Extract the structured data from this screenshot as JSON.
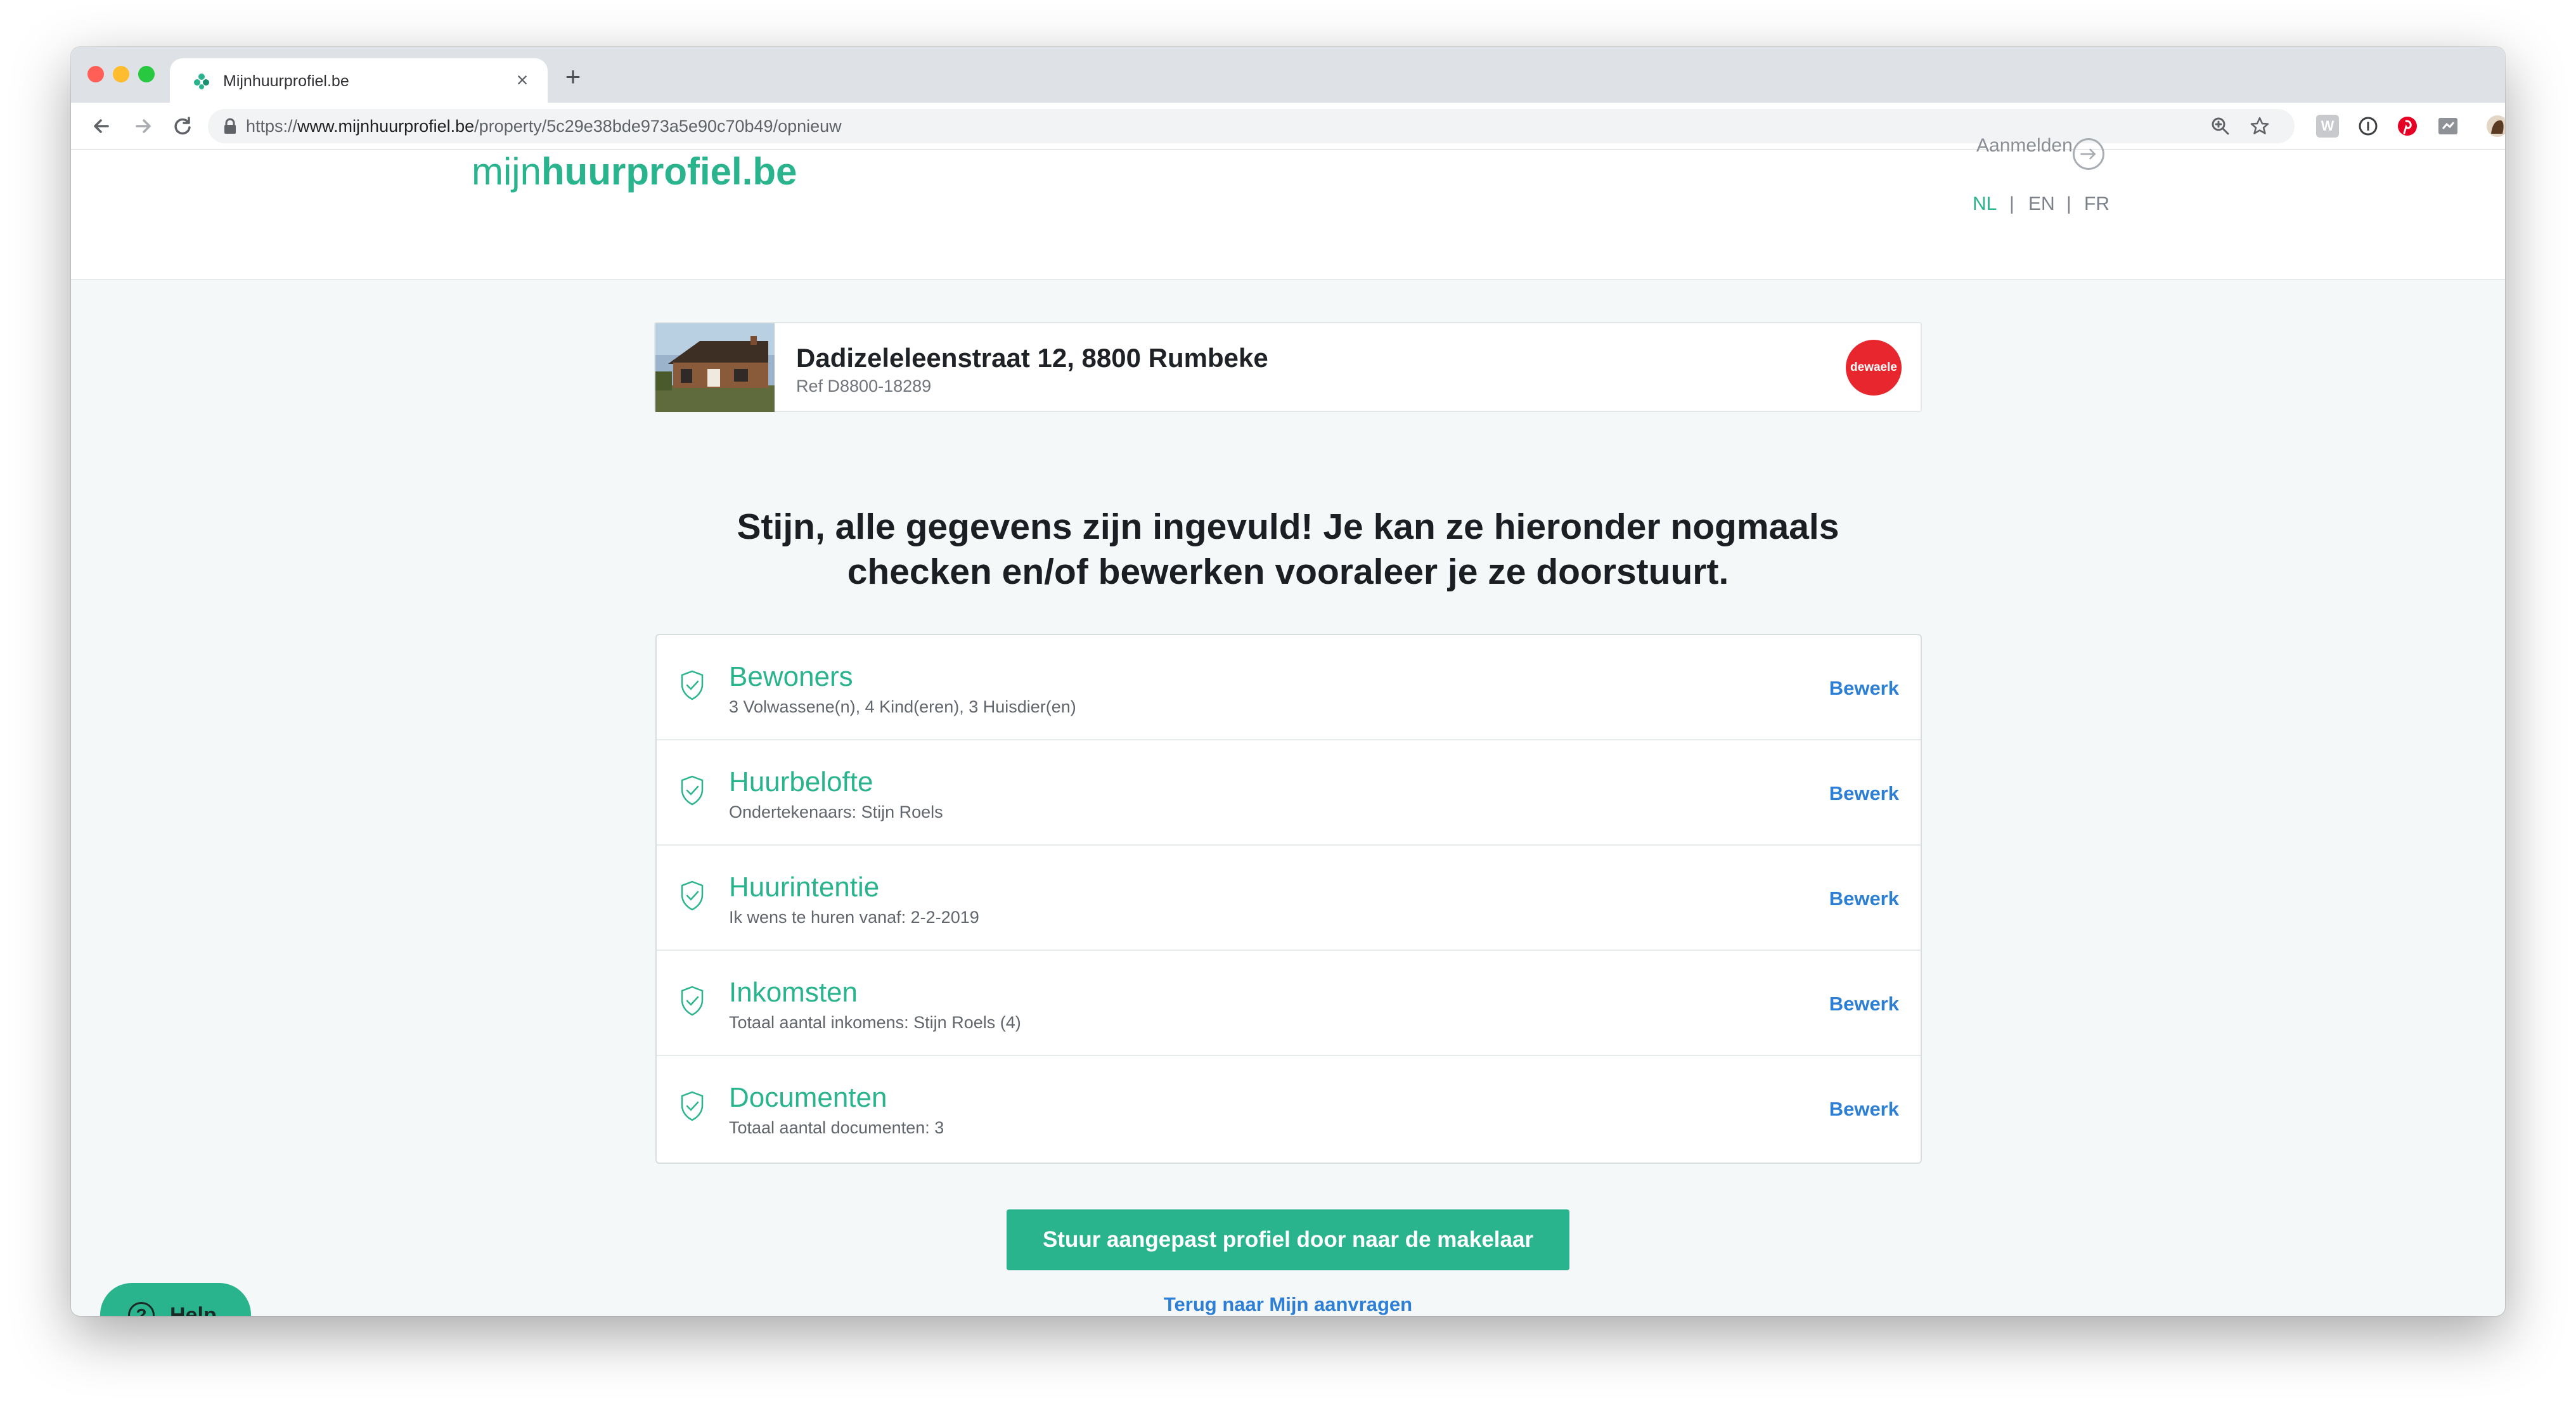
{
  "browser": {
    "tab_title": "Mijnhuurprofiel.be",
    "tab_close": "×",
    "new_tab": "+",
    "url_prefix": "https://",
    "url_host": "www.mijnhuurprofiel.be",
    "url_path": "/property/5c29e38bde973a5e90c70b49/opnieuw",
    "icons": [
      "back-icon",
      "forward-icon",
      "reload-icon",
      "lock-icon",
      "zoom-icon",
      "star-icon",
      "menu-icon"
    ]
  },
  "header": {
    "logo_light": "mijn",
    "logo_bold": "huurprofiel.be",
    "login_label": "Aanmelden",
    "languages": [
      {
        "code": "NL",
        "active": true
      },
      {
        "code": "EN",
        "active": false
      },
      {
        "code": "FR",
        "active": false
      }
    ],
    "separator": "|"
  },
  "property": {
    "address": "Dadizeleleenstraat 12, 8800 Rumbeke",
    "ref": "Ref D8800-18289",
    "agency": "dewaele"
  },
  "headline": {
    "line1": "Stijn, alle gegevens zijn ingevuld! Je kan ze hieronder nogmaals",
    "line2": "checken en/of bewerken vooraleer je ze doorstuurt."
  },
  "sections": [
    {
      "title": "Bewoners",
      "subtitle": "3 Volwassene(n), 4 Kind(eren), 3 Huisdier(en)",
      "action": "Bewerk"
    },
    {
      "title": "Huurbelofte",
      "subtitle": "Ondertekenaars: Stijn Roels",
      "action": "Bewerk"
    },
    {
      "title": "Huurintentie",
      "subtitle": "Ik wens te huren vanaf: 2-2-2019",
      "action": "Bewerk"
    },
    {
      "title": "Inkomsten",
      "subtitle": "Totaal aantal inkomens: Stijn Roels (4)",
      "action": "Bewerk"
    },
    {
      "title": "Documenten",
      "subtitle": "Totaal aantal documenten: 3",
      "action": "Bewerk"
    }
  ],
  "actions": {
    "submit": "Stuur aangepast profiel door naar de makelaar",
    "back": "Terug naar Mijn aanvragen"
  },
  "help": {
    "icon_glyph": "?",
    "label": "Help"
  },
  "colors": {
    "brand_green": "#2ab48e",
    "link_blue": "#2d7fd6",
    "agency_red": "#e8262d"
  }
}
